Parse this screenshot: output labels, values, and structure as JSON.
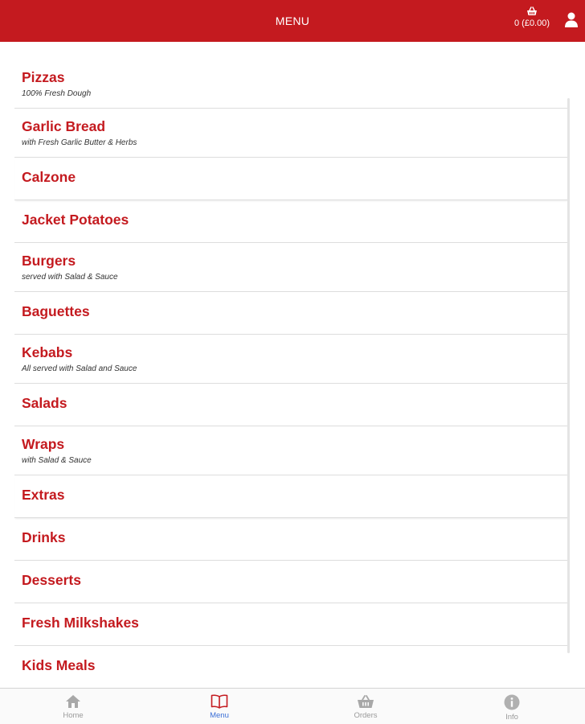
{
  "header": {
    "title": "MENU",
    "basket_amount": "0 (£0.00)",
    "accent": "#c41a1f"
  },
  "categories": [
    {
      "name": "Pizzas",
      "desc": "100% Fresh Dough"
    },
    {
      "name": "Garlic Bread",
      "desc": "with Fresh Garlic Butter & Herbs"
    },
    {
      "name": "Calzone",
      "desc": ""
    },
    {
      "name": "Jacket Potatoes",
      "desc": ""
    },
    {
      "name": "Burgers",
      "desc": "served with Salad & Sauce"
    },
    {
      "name": "Baguettes",
      "desc": ""
    },
    {
      "name": "Kebabs",
      "desc": "All served with Salad and Sauce"
    },
    {
      "name": "Salads",
      "desc": ""
    },
    {
      "name": "Wraps",
      "desc": "with Salad & Sauce"
    },
    {
      "name": "Extras",
      "desc": ""
    },
    {
      "name": "Drinks",
      "desc": ""
    },
    {
      "name": "Desserts",
      "desc": ""
    },
    {
      "name": "Fresh Milkshakes",
      "desc": ""
    },
    {
      "name": "Kids Meals",
      "desc": ""
    }
  ],
  "bottom_nav": [
    {
      "label": "Home",
      "icon": "home-icon",
      "active": false
    },
    {
      "label": "Menu",
      "icon": "book-icon",
      "active": true
    },
    {
      "label": "Orders",
      "icon": "basket-icon",
      "active": false
    },
    {
      "label": "Info",
      "icon": "info-icon",
      "active": false
    }
  ],
  "colors": {
    "nav_active": "#3b6fd6",
    "nav_inactive": "#9a9a9a"
  }
}
